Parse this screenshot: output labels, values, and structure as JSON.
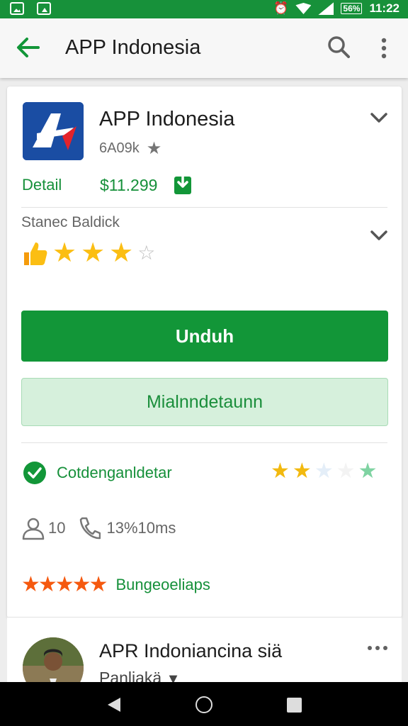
{
  "status_bar": {
    "time": "11:22",
    "battery": "56%",
    "alarm_icon": "alarm-icon",
    "wifi_icon": "wifi-icon",
    "signal_icon": "signal-icon"
  },
  "app_bar": {
    "title": "APP Indonesia",
    "back_icon": "arrow-back-icon",
    "search_icon": "search-icon",
    "more_icon": "more-vert-icon"
  },
  "app": {
    "name": "APP Indonesia",
    "meta": "6A09k",
    "detail_label": "Detail",
    "price": "$11.299",
    "sub_label": "Stanec Baldick",
    "rating_filled": 4,
    "rating_total": 5
  },
  "buttons": {
    "primary": "Unduh",
    "secondary": "Mialnndetaunn"
  },
  "verification": {
    "text": "Cotdenganldetar"
  },
  "stats": {
    "users": "10",
    "size": "13%10ms"
  },
  "rating_link": "Bungeoeliaps",
  "review": {
    "name": "APR Indoniancina siä",
    "subtitle": "Panliakä"
  },
  "colors": {
    "accent": "#129638",
    "status_bar": "#17913a",
    "star": "#fbbe13",
    "orange_star": "#f5590f"
  }
}
